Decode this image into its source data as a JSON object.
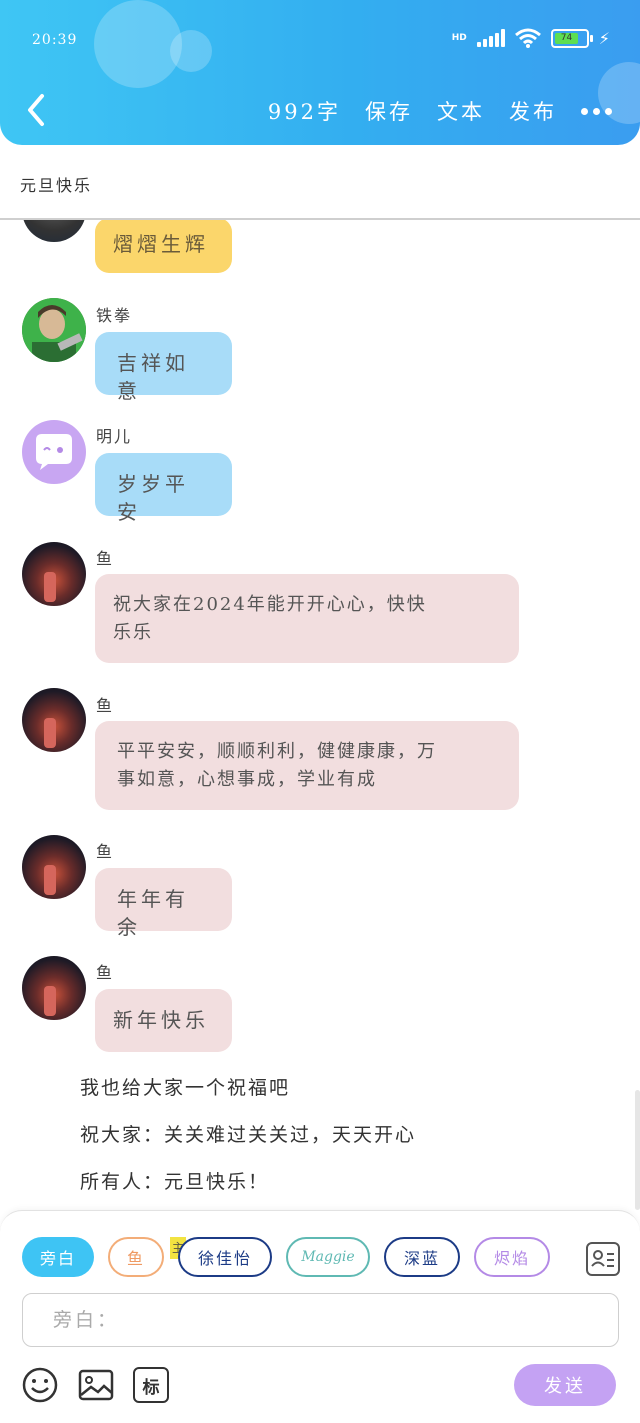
{
  "status_bar": {
    "time": "20:39",
    "network": "HD",
    "battery": "74"
  },
  "header": {
    "word_count": "992字",
    "save_label": "保存",
    "text_label": "文本",
    "publish_label": "发布"
  },
  "title": "元旦快乐",
  "messages": [
    {
      "sender": "",
      "text": "熠熠生辉"
    },
    {
      "sender": "铁拳",
      "text": "吉祥如意"
    },
    {
      "sender": "明儿",
      "text": "岁岁平安"
    },
    {
      "sender": "鱼",
      "text_line1": "祝大家在2024年能开开心心，快快",
      "text_line2": "乐乐"
    },
    {
      "sender": "鱼",
      "text_line1": "平平安安，顺顺利利，健健康康，万",
      "text_line2": "事如意，心想事成，学业有成"
    },
    {
      "sender": "鱼",
      "text": "年年有余"
    },
    {
      "sender": "鱼",
      "text": "新年快乐"
    }
  ],
  "narration": [
    "我也给大家一个祝福吧",
    "祝大家：关关难过关关过，天天开心",
    "所有人：元旦快乐！"
  ],
  "roles": {
    "narrator": "旁白",
    "yu": "鱼",
    "main_badge": "主",
    "xu": "徐佳怡",
    "maggie": "Maggie",
    "shenlan": "深蓝",
    "xiyan": "烬焰"
  },
  "input": {
    "placeholder": "旁白："
  },
  "toolbar": {
    "tag_label": "标",
    "send_label": "发送"
  },
  "colors": {
    "header_start": "#3fc6f4",
    "header_end": "#3a9df0",
    "send_button": "#c4a2f3",
    "bubble_pink": "#f2dedf",
    "bubble_blue": "#a8dcf8",
    "bubble_yellow": "#fbd66b"
  },
  "icons": [
    "back-arrow-icon",
    "more-icon",
    "contact-card-icon",
    "emoji-icon",
    "image-icon",
    "tag-icon"
  ]
}
